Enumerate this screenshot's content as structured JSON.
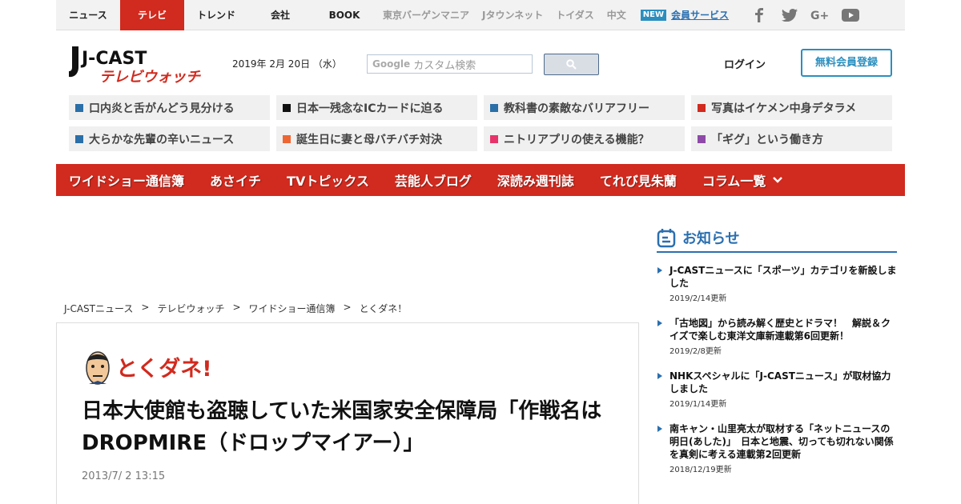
{
  "topnav": {
    "main": [
      "ニュース",
      "テレビ",
      "トレンド",
      "会社",
      "BOOK"
    ],
    "sub": [
      "東京バーゲンマニア",
      "Jタウンネット",
      "トイダス",
      "中文"
    ],
    "new_badge": "NEW",
    "member": "会員サービス"
  },
  "header": {
    "logo_main": "J-CAST",
    "logo_sub": "テレビウォッチ",
    "date": "2019年 2月 20日 （水）",
    "search_brand": "Google",
    "search_placeholder": "カスタム検索",
    "login": "ログイン",
    "register": "無料会員登録"
  },
  "topics": [
    {
      "label": "口内炎と舌がんどう見分ける",
      "color": "#2a6fa8"
    },
    {
      "label": "日本一残念なICカードに迫る",
      "color": "#111111"
    },
    {
      "label": "教科書の素敵なバリアフリー",
      "color": "#2a6fa8"
    },
    {
      "label": "写真はイケメン中身デタラメ",
      "color": "#d12a1e"
    },
    {
      "label": "大らかな先輩の辛いニュース",
      "color": "#2a6fa8"
    },
    {
      "label": "誕生日に妻と母バチバチ対決",
      "color": "#ee6633"
    },
    {
      "label": "ニトリアプリの使える機能？",
      "color": "#e8336a"
    },
    {
      "label": "「ギグ」という働き方",
      "color": "#8e4aa8"
    }
  ],
  "rednav": [
    "ワイドショー通信簿",
    "あさイチ",
    "TVトピックス",
    "芸能人ブログ",
    "深読み週刊誌",
    "てれび見朱蘭",
    "コラム一覧"
  ],
  "breadcrumb": [
    "J-CASTニュース",
    ">",
    "テレビウォッチ",
    ">",
    "ワイドショー通信簿",
    ">",
    "とくダネ！"
  ],
  "article": {
    "program": "とくダネ!",
    "headline": "日本大使館も盗聴していた米国家安全保障局「作戦名はDROPMIRE（ドロップマイアー）」",
    "date": "2013/7/ 2 13:15"
  },
  "sidebar": {
    "title": "お知らせ",
    "news": [
      {
        "title": "J-CASTニュースに「スポーツ」カテゴリを新設しました",
        "date": "2019/2/14更新"
      },
      {
        "title": "「古地図」から読み解く歴史とドラマ！　解説＆クイズで楽しむ東洋文庫新連載第6回更新！",
        "date": "2019/2/8更新"
      },
      {
        "title": "NHKスペシャルに「J-CASTニュース」が取材協力しました",
        "date": "2019/1/14更新"
      },
      {
        "title": "南キャン・山里亮太が取材する「ネットニュースの明日(あした)」　日本と地震、切っても切れない関係を真剣に考える連載第2回更新",
        "date": "2018/12/19更新"
      }
    ]
  },
  "colors": {
    "brand_red": "#d12a1e",
    "accent_blue": "#2a6fb0",
    "link_blue": "#2a8fbf"
  }
}
